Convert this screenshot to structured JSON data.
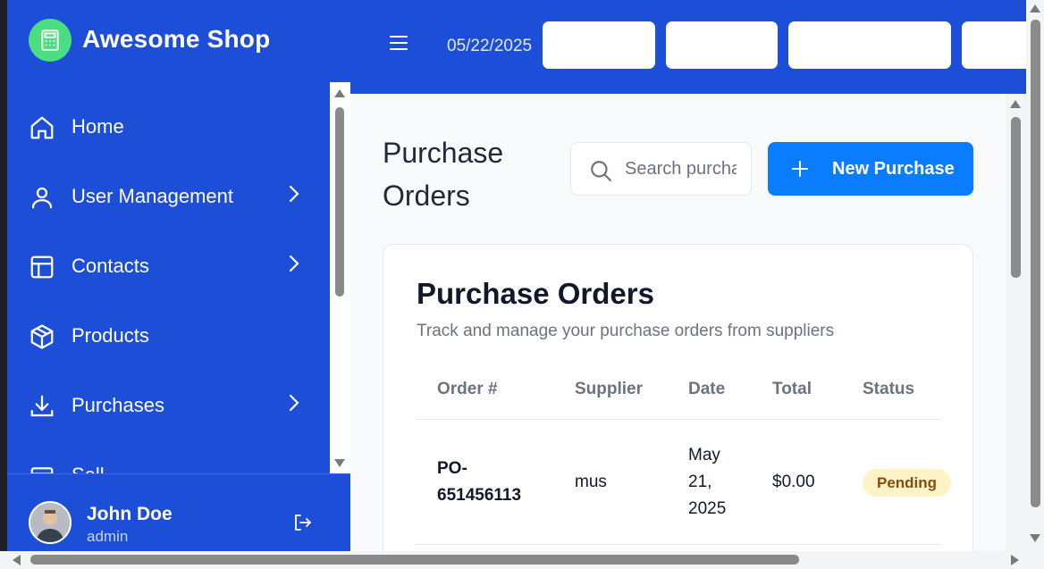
{
  "brand": {
    "name": "Awesome Shop",
    "accent": "#1d4ed8",
    "logo_color": "#4ade80",
    "logo_icon": "calculator-icon"
  },
  "header": {
    "date": "05/22/2025",
    "menu_icon": "hamburger-icon"
  },
  "sidebar": {
    "items": [
      {
        "label": "Home",
        "icon": "home-icon",
        "has_children": false
      },
      {
        "label": "User Management",
        "icon": "user-icon",
        "has_children": true
      },
      {
        "label": "Contacts",
        "icon": "layout-icon",
        "has_children": true
      },
      {
        "label": "Products",
        "icon": "box-icon",
        "has_children": false
      },
      {
        "label": "Purchases",
        "icon": "download-icon",
        "has_children": true
      },
      {
        "label": "Sell",
        "icon": "cart-icon",
        "has_children": true
      }
    ]
  },
  "user": {
    "name": "John Doe",
    "role": "admin",
    "logout_icon": "logout-icon"
  },
  "main": {
    "title": "Purchase Orders",
    "search_placeholder": "Search purchases...",
    "new_button": "New Purchase",
    "card": {
      "title": "Purchase Orders",
      "subtitle": "Track and manage your purchase orders from suppliers",
      "columns": [
        "Order #",
        "Supplier",
        "Date",
        "Total",
        "Status"
      ],
      "rows": [
        {
          "order": "PO-651456113",
          "supplier": "mus",
          "date": "May 21, 2025",
          "total": "$0.00",
          "status": "Pending"
        }
      ]
    }
  },
  "colors": {
    "primary_button": "#0a7cff",
    "pending_badge_bg": "#fef3c7",
    "pending_badge_text": "#854d0e"
  }
}
